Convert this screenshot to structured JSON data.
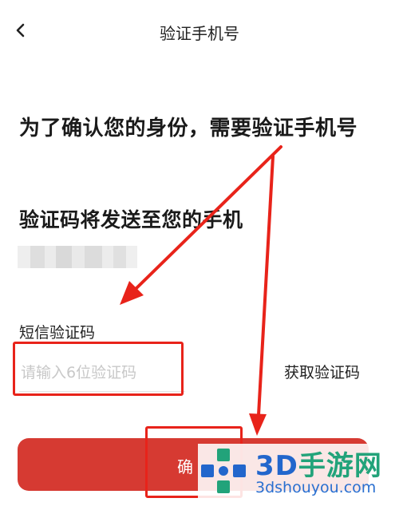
{
  "header": {
    "title": "验证手机号"
  },
  "main": {
    "heading": "为了确认您的身份，需要验证手机号",
    "subheading": "验证码将发送至您的手机",
    "phone_masked": "",
    "code_label": "短信验证码",
    "code_placeholder": "请输入6位验证码",
    "code_value": "",
    "get_code_label": "获取验证码",
    "confirm_label": "确"
  },
  "watermark": {
    "brand_num": "3D",
    "brand_cn": "手游网",
    "site": "3dshouyou.com"
  },
  "colors": {
    "accent": "#d63a32",
    "annotation": "#e8231a",
    "watermark_blue": "#2266cc",
    "watermark_green": "#22a37a"
  },
  "icons": {
    "back": "chevron-left-icon",
    "watermark_logo": "gamepad-logo-icon"
  }
}
